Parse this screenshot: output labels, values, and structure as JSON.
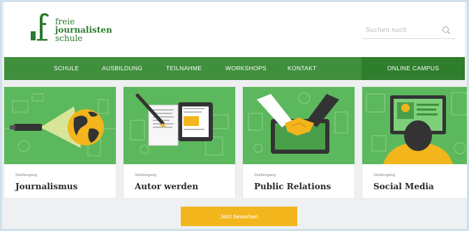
{
  "logo": {
    "line1": "freie",
    "line2": "journalisten",
    "line3": "schule"
  },
  "search": {
    "placeholder": "Suchen nach"
  },
  "nav": {
    "items": [
      "SCHULE",
      "AUSBILDUNG",
      "TEILNAHME",
      "WORKSHOPS",
      "KONTAKT"
    ],
    "campus": "ONLINE CAMPUS"
  },
  "cards": [
    {
      "subtitle": "Studiengang",
      "title": "Journalismus"
    },
    {
      "subtitle": "Studiengang",
      "title": "Autor werden"
    },
    {
      "subtitle": "Studiengang",
      "title": "Public Relations"
    },
    {
      "subtitle": "Studiengang",
      "title": "Social Media"
    }
  ],
  "cta": {
    "label": "Jetzt bewerben"
  },
  "colors": {
    "brand_green": "#3f8f3d",
    "card_green": "#5cb85c",
    "accent_yellow": "#f2b51b"
  }
}
